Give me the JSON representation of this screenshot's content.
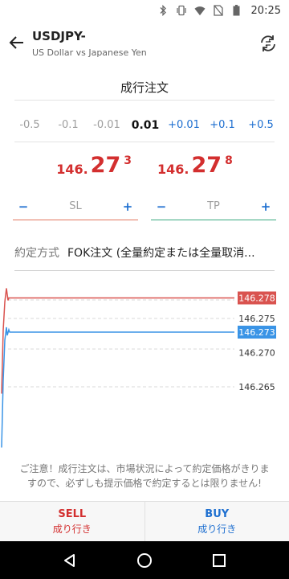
{
  "status_bar": {
    "time": "20:25",
    "icons": [
      "bluetooth-icon",
      "vibrate-icon",
      "wifi-icon",
      "sim-off-icon",
      "battery-icon"
    ]
  },
  "header": {
    "symbol": "USDJPY-",
    "subtitle": "US Dollar vs Japanese Yen",
    "back_icon": "arrow-left-icon",
    "switch_icon": "refresh-swap-icon"
  },
  "order_type": "成行注文",
  "volume_steps": [
    "-0.5",
    "-0.1",
    "-0.01",
    "0.01",
    "+0.01",
    "+0.1",
    "+0.5"
  ],
  "prices": {
    "sell": {
      "prefix": "146.",
      "big": "27",
      "sup": "3"
    },
    "buy": {
      "prefix": "146.",
      "big": "27",
      "sup": "8"
    }
  },
  "stop_loss": {
    "minus": "−",
    "label": "SL",
    "plus": "+"
  },
  "take_profit": {
    "minus": "−",
    "label": "TP",
    "plus": "+"
  },
  "execution": {
    "label": "約定方式",
    "value": "FOK注文 (全量約定または全量取消..."
  },
  "chart_data": {
    "type": "line",
    "y_ticks": [
      "146.275",
      "146.270",
      "146.265"
    ],
    "price_tags": {
      "ask": "146.278",
      "bid": "146.273"
    },
    "series": [
      {
        "values": [
          146.264,
          146.278,
          146.278
        ]
      },
      {
        "values": [
          146.262,
          146.273,
          146.273
        ]
      }
    ],
    "colors": {
      "ask": "#d9534f",
      "bid": "#3a94e6"
    },
    "grid": true
  },
  "notice": "ご注意！成行注文は、市場状況によって約定価格がきますので、必ずしも提示価格で約定するとは限りません!",
  "notice_lines": [
    "ご注意！成行注文は、市場状況によって約定価格がきりま",
    "すので、必ずしも提示価格で約定するとは限りません!"
  ],
  "actions": {
    "sell": {
      "label": "SELL",
      "sub": "成り行き"
    },
    "buy": {
      "label": "BUY",
      "sub": "成り行き"
    }
  },
  "nav": [
    "back-triangle-icon",
    "home-circle-icon",
    "recents-square-icon"
  ]
}
